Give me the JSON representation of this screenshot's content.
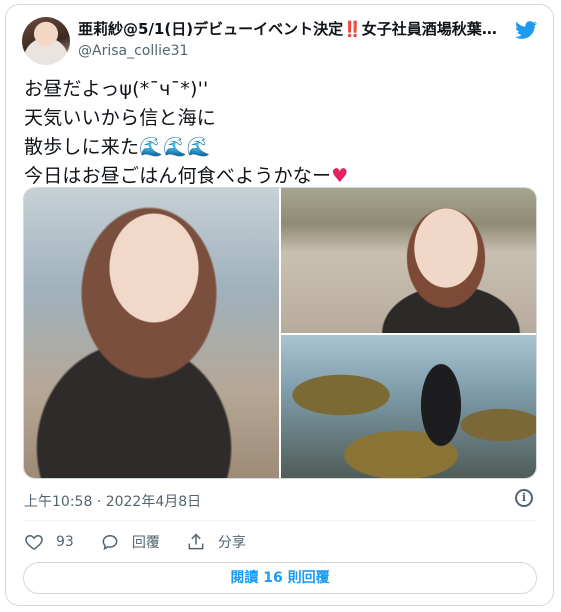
{
  "user": {
    "display_name_prefix": "亜莉紗@",
    "display_name_bold": "5/1(日)",
    "display_name_mid": "デビューイベント決定",
    "display_name_warn": "‼️",
    "display_name_suffix": "女子社員酒場秋葉原…",
    "handle": "@Arisa_collie31"
  },
  "tweet": {
    "text": "お昼だよっψ(*¯ч¯*)''\n天気いいから信と海に\n散歩しに来た🌊🌊🌊\n今日はお昼ごはん何食べようかなー",
    "heart": "♥"
  },
  "media": {
    "photos": [
      "selfie-beach-left",
      "selfie-beach-right",
      "dog-on-rocks"
    ]
  },
  "meta": {
    "timestamp": "上午10:58 · 2022年4月8日"
  },
  "actions": {
    "like_count": "93",
    "reply_label": "回覆",
    "share_label": "分享"
  },
  "replies_button": {
    "prefix": "閱讀 ",
    "count": "16",
    "suffix": " 則回覆"
  },
  "colors": {
    "accent": "#1d9bf0",
    "heart": "#e0245e",
    "secondary_text": "#536471"
  },
  "icons": {
    "brand": "twitter-bird-icon",
    "info": "info-icon",
    "like": "heart-icon",
    "reply": "reply-icon",
    "share": "share-icon"
  }
}
